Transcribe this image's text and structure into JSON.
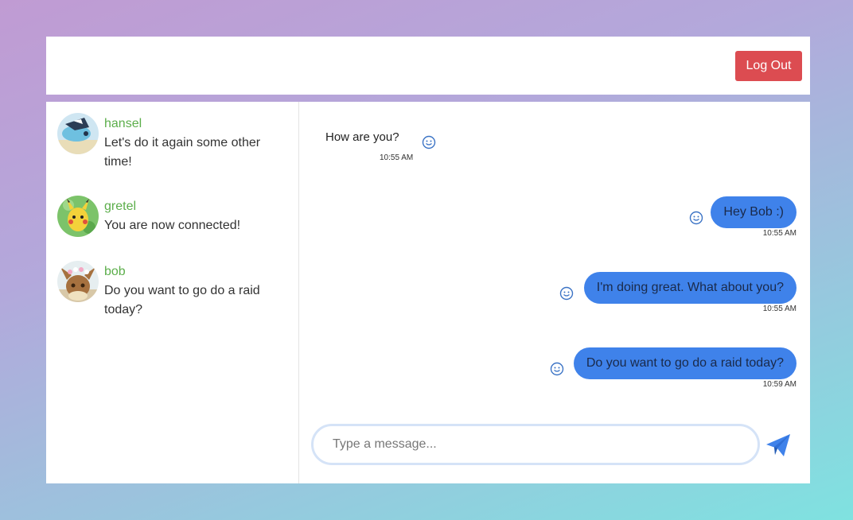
{
  "header": {
    "logout_label": "Log Out"
  },
  "contacts": [
    {
      "name": "hansel",
      "last_message": "Let's do it again some other time!"
    },
    {
      "name": "gretel",
      "last_message": "You are now connected!"
    },
    {
      "name": "bob",
      "last_message": "Do you want to go do a raid today?"
    }
  ],
  "messages": [
    {
      "direction": "incoming",
      "text": "How are you?",
      "time": "10:55 AM"
    },
    {
      "direction": "outgoing",
      "text": "Hey Bob :)",
      "time": "10:55 AM"
    },
    {
      "direction": "outgoing",
      "text": "I'm doing great. What about you?",
      "time": "10:55 AM"
    },
    {
      "direction": "outgoing",
      "text": "Do you want to go do a raid today?",
      "time": "10:59 AM"
    }
  ],
  "composer": {
    "placeholder": "Type a message..."
  },
  "icons": {
    "reaction": "smiley-icon",
    "send": "paper-plane-icon"
  },
  "colors": {
    "logout": "#dc4c51",
    "outgoing_bubble": "#3f82ea",
    "contact_name": "#5cae4b",
    "send_icon": "#3f82ea"
  }
}
